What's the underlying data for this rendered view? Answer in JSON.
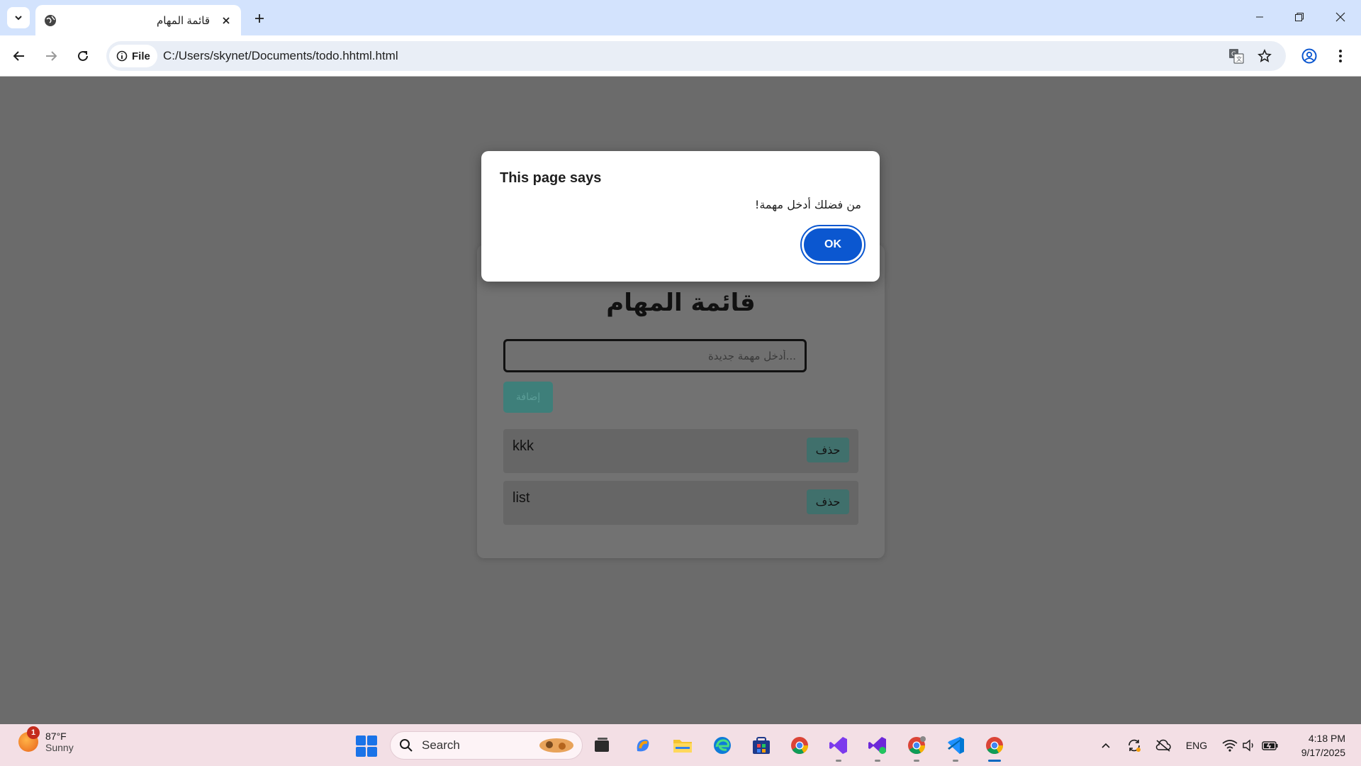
{
  "browser": {
    "tab_title": "قائمة المهام",
    "url_chip": "File",
    "url": "C:/Users/skynet/Documents/todo.hhtml.html"
  },
  "page": {
    "title": "قائمة المهام",
    "input_placeholder": "...أدخل مهمة جديدة",
    "add_button": "إضافة",
    "tasks": [
      {
        "name": "kkk",
        "delete_label": "حذف"
      },
      {
        "name": "list",
        "delete_label": "حذف"
      }
    ]
  },
  "dialog": {
    "heading": "This page says",
    "message": "من فضلك أدخل مهمة!",
    "ok_label": "OK"
  },
  "taskbar": {
    "weather_badge": "1",
    "temperature": "87°F",
    "condition": "Sunny",
    "search_label": "Search",
    "language": "ENG",
    "time": "4:18 PM",
    "date": "9/17/2025"
  },
  "colors": {
    "accent": "#0b57d0",
    "tabstrip": "#d3e3fd",
    "taskbar": "#f3dfe5"
  }
}
